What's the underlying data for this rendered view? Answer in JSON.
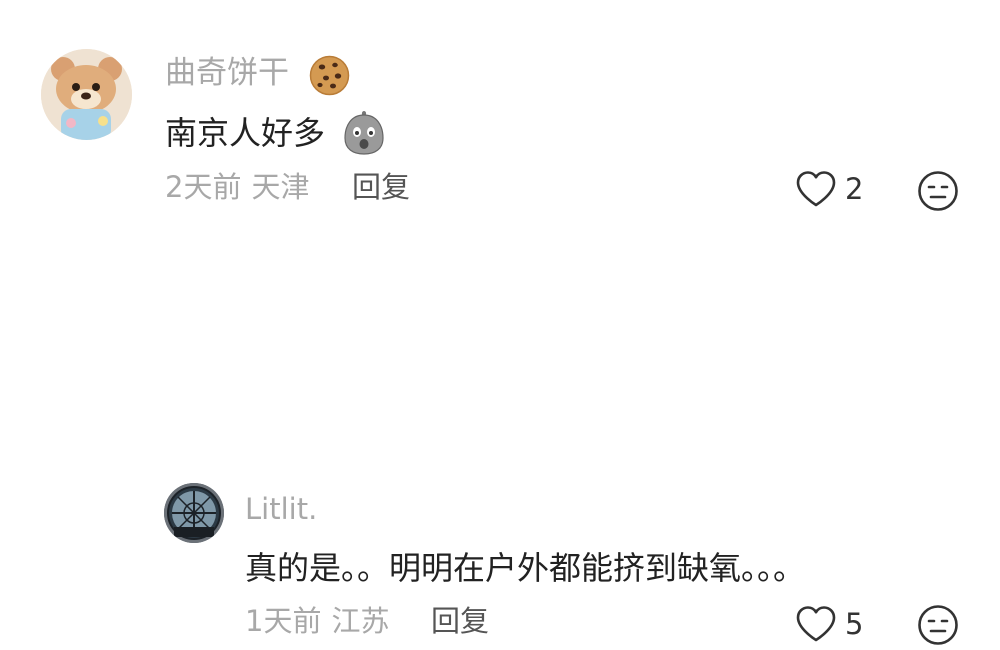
{
  "comments": [
    {
      "username": "曲奇饼干",
      "username_emoji_icon": "cookie-icon",
      "text": "南京人好多",
      "text_emoji_icon": "shocked-face-icon",
      "time": "2天前",
      "location": "天津",
      "reply_label": "回复",
      "like_count": "2"
    },
    {
      "username": "Litlit.",
      "text": "真的是。。明明在户外都能挤到缺氧。。。",
      "time": "1天前",
      "location": "江苏",
      "reply_label": "回复",
      "like_count": "5"
    }
  ],
  "icons": {
    "like": "heart-outline-icon",
    "dislike": "frown-face-icon"
  },
  "colors": {
    "muted_text": "#a8a8a8",
    "body_text": "#222222",
    "reply_text": "#555555"
  }
}
